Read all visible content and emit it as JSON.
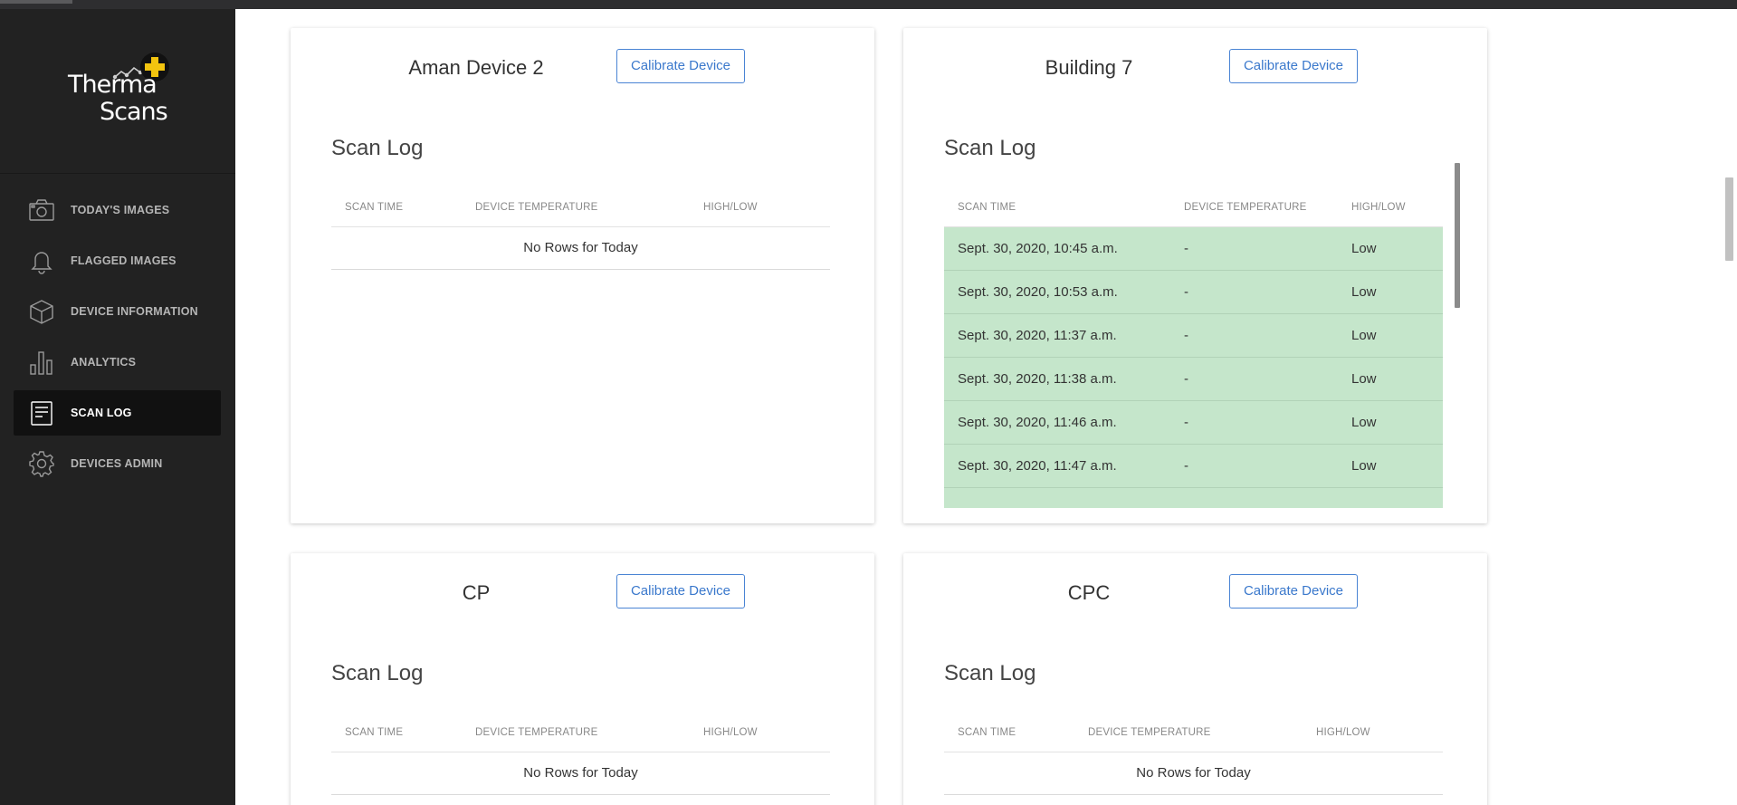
{
  "app": {
    "brand_line1": "Therma",
    "brand_line2": "Scans"
  },
  "sidebar": {
    "items": [
      {
        "label": "TODAY'S IMAGES",
        "icon": "camera-icon",
        "active": false
      },
      {
        "label": "FLAGGED IMAGES",
        "icon": "bell-icon",
        "active": false
      },
      {
        "label": "DEVICE INFORMATION",
        "icon": "cube-icon",
        "active": false
      },
      {
        "label": "ANALYTICS",
        "icon": "bar-chart-icon",
        "active": false
      },
      {
        "label": "SCAN LOG",
        "icon": "document-list-icon",
        "active": true
      },
      {
        "label": "DEVICES ADMIN",
        "icon": "gear-icon",
        "active": false
      }
    ]
  },
  "columns": {
    "scan_time": "SCAN TIME",
    "device_temperature": "DEVICE TEMPERATURE",
    "high_low": "HIGH/LOW"
  },
  "devices": [
    {
      "name": "Aman Device 2",
      "button": "Calibrate Device",
      "log_title": "Scan Log",
      "empty_text": "No Rows for Today",
      "rows": []
    },
    {
      "name": "Building 7",
      "button": "Calibrate Device",
      "log_title": "Scan Log",
      "empty_text": "",
      "rows": [
        {
          "time": "Sept. 30, 2020, 10:45 a.m.",
          "temp": "-",
          "level": "Low"
        },
        {
          "time": "Sept. 30, 2020, 10:53 a.m.",
          "temp": "-",
          "level": "Low"
        },
        {
          "time": "Sept. 30, 2020, 11:37 a.m.",
          "temp": "-",
          "level": "Low"
        },
        {
          "time": "Sept. 30, 2020, 11:38 a.m.",
          "temp": "-",
          "level": "Low"
        },
        {
          "time": "Sept. 30, 2020, 11:46 a.m.",
          "temp": "-",
          "level": "Low"
        },
        {
          "time": "Sept. 30, 2020, 11:47 a.m.",
          "temp": "-",
          "level": "Low"
        }
      ]
    },
    {
      "name": "CP",
      "button": "Calibrate Device",
      "log_title": "Scan Log",
      "empty_text": "No Rows for Today",
      "rows": []
    },
    {
      "name": "CPC",
      "button": "Calibrate Device",
      "log_title": "Scan Log",
      "empty_text": "No Rows for Today",
      "rows": []
    }
  ],
  "colors": {
    "sidebar_bg": "#222222",
    "accent": "#3a78cc",
    "low_row": "#c5e6cb",
    "logo_plus": "#f2c40f"
  }
}
